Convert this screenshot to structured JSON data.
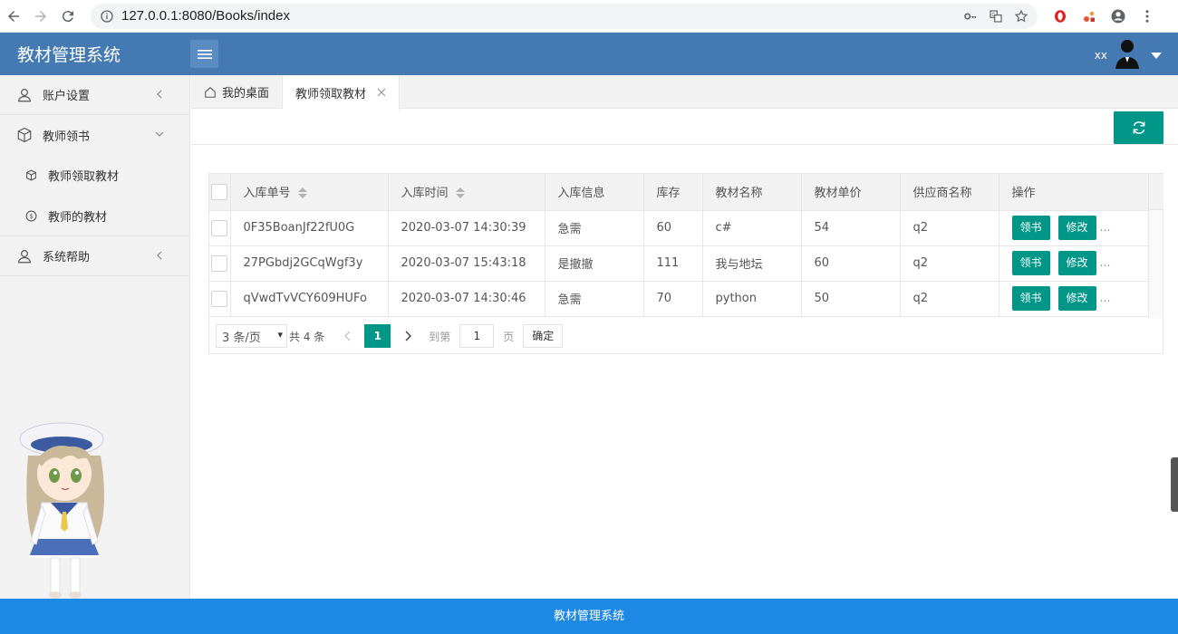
{
  "browser": {
    "url": "127.0.0.1:8080/Books/index"
  },
  "header": {
    "title": "教材管理系统",
    "user": "xx"
  },
  "sidebar": {
    "items": [
      {
        "label": "账户设置"
      },
      {
        "label": "教师领书"
      },
      {
        "label": "系统帮助"
      }
    ],
    "subitems": [
      {
        "label": "教师领取教材"
      },
      {
        "label": "教师的教材"
      }
    ]
  },
  "tabs": [
    {
      "label": "我的桌面"
    },
    {
      "label": "教师领取教材"
    }
  ],
  "table": {
    "columns": [
      "入库单号",
      "入库时间",
      "入库信息",
      "库存",
      "教材名称",
      "教材单价",
      "供应商名称",
      "操作"
    ],
    "rows": [
      {
        "id": "0F35BoanJf22fU0G",
        "time": "2020-03-07 14:30:39",
        "info": "急需",
        "stock": "60",
        "name": "c#",
        "price": "54",
        "supplier": "q2"
      },
      {
        "id": "27PGbdj2GCqWgf3y",
        "time": "2020-03-07 15:43:18",
        "info": "是撤撤",
        "stock": "111",
        "name": "我与地坛",
        "price": "60",
        "supplier": "q2"
      },
      {
        "id": "qVwdTvVCY609HUFo",
        "time": "2020-03-07 14:30:46",
        "info": "急需",
        "stock": "70",
        "name": "python",
        "price": "50",
        "supplier": "q2"
      }
    ],
    "action_take": "领书",
    "action_edit": "修改",
    "action_more": "…"
  },
  "pager": {
    "page_size": "3 条/页",
    "total": "共 4 条",
    "current": "1",
    "goto_label": "到第",
    "goto_value": "1",
    "page_label": "页",
    "confirm": "确定"
  },
  "footer": {
    "text": "教材管理系统"
  },
  "colors": {
    "header": "#4479b2",
    "primary": "#009688",
    "footer": "#1e88e5"
  }
}
